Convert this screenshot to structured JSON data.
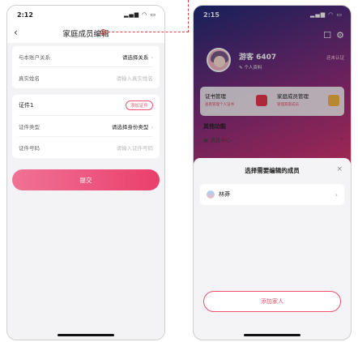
{
  "left_phone": {
    "status_time": "2:12",
    "status_icons": "▂▄▆ ◠ ▭",
    "nav": {
      "back": "‹",
      "title": "家庭成员编辑"
    },
    "relation": {
      "label": "与本账户关系",
      "value": "请选择关系"
    },
    "real_name": {
      "label": "真实姓名",
      "placeholder": "请输入真实姓名"
    },
    "certificate": {
      "title": "证件1",
      "add_label": "添加证件",
      "type_label": "证件类型",
      "type_value": "请选择身份类型",
      "number_label": "证件号码",
      "number_placeholder": "请输入证件号码"
    },
    "submit_label": "提交"
  },
  "right_phone": {
    "status_time": "2:15",
    "status_icons": "▂▄▆ ◠ ▭",
    "top_icons": {
      "message": "☐",
      "settings": "⚙"
    },
    "user": {
      "name": "游客 6407",
      "sub": "个人资料",
      "cert_status": "还未认证"
    },
    "features": [
      {
        "title": "证书管理",
        "sub": "查看管理个人证书",
        "icon_color": "#e8364f"
      },
      {
        "title": "家庭成员管理",
        "sub": "管理家庭成员",
        "icon_color": "#f6b441"
      }
    ],
    "other_title": "其他功能",
    "message_center": "消息中心",
    "sheet": {
      "title": "选择需要编辑的成员",
      "close": "×",
      "members": [
        {
          "name": "林莽",
          "chev": "›"
        }
      ],
      "add_label": "添加家人"
    }
  },
  "colors": {
    "accent": "#ec4f70",
    "marker": "#e04040"
  }
}
